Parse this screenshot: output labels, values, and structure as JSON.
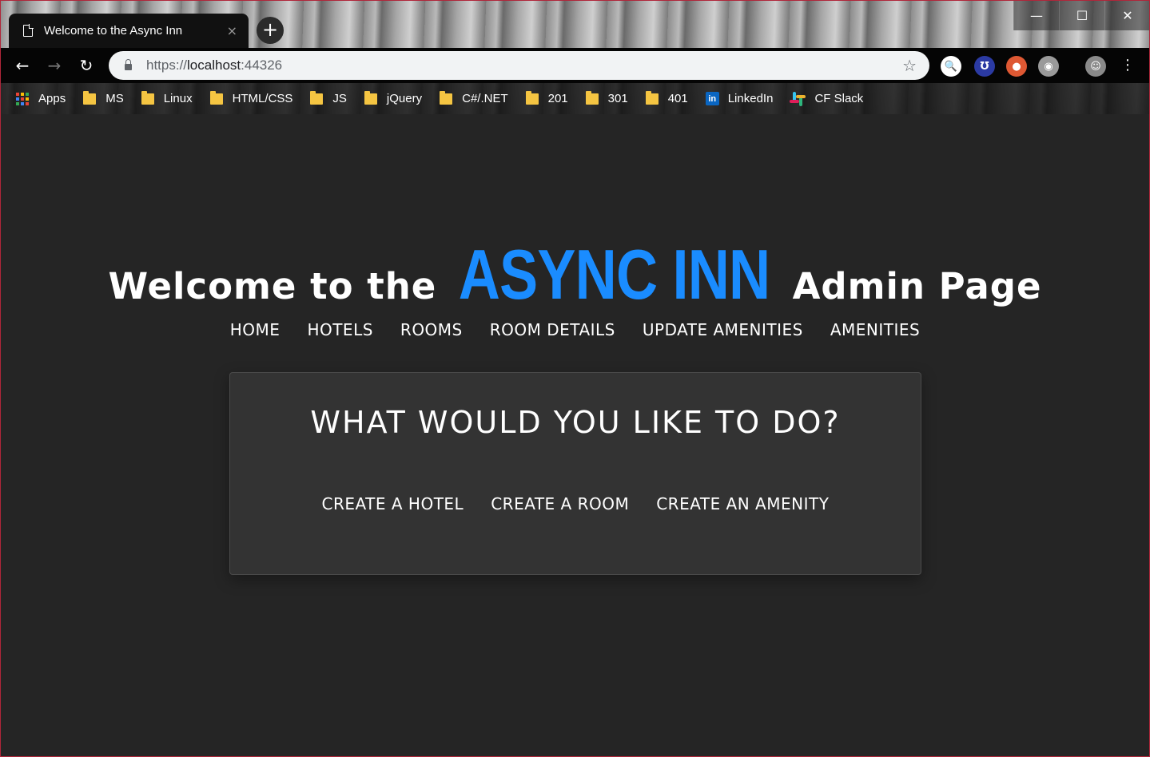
{
  "browser": {
    "tab_title": "Welcome to the Async Inn",
    "tab_close": "×",
    "new_tab": "+",
    "url_scheme": "https://",
    "url_host": "localhost",
    "url_port": ":44326",
    "window_controls": {
      "minimize": "—",
      "maximize": "☐",
      "close": "✕"
    },
    "nav": {
      "back": "←",
      "forward": "→",
      "reload": "↻"
    },
    "star": "☆",
    "extensions": [
      {
        "name": "search-extension-icon",
        "glyph": "🔍",
        "color": "#1a73e8"
      },
      {
        "name": "tampermonkey-icon",
        "glyph": "Ʊ",
        "color": "#2b3aa3"
      },
      {
        "name": "duckduckgo-icon",
        "glyph": "●",
        "color": "#de5833"
      },
      {
        "name": "ghostery-icon",
        "glyph": "◉",
        "color": "#9a9a9a"
      }
    ],
    "menu": "⋮"
  },
  "bookmarks": [
    {
      "label": "Apps",
      "type": "apps"
    },
    {
      "label": "MS",
      "type": "folder"
    },
    {
      "label": "Linux",
      "type": "folder"
    },
    {
      "label": "HTML/CSS",
      "type": "folder"
    },
    {
      "label": "JS",
      "type": "folder"
    },
    {
      "label": "jQuery",
      "type": "folder"
    },
    {
      "label": "C#/.NET",
      "type": "folder"
    },
    {
      "label": "201",
      "type": "folder"
    },
    {
      "label": "301",
      "type": "folder"
    },
    {
      "label": "401",
      "type": "folder"
    },
    {
      "label": "LinkedIn",
      "type": "linkedin"
    },
    {
      "label": "CF Slack",
      "type": "slack"
    }
  ],
  "hero": {
    "prefix": "Welcome to the",
    "brand": "ASYNC INN",
    "suffix": "Admin Page",
    "brand_color": "#1a8cff"
  },
  "nav": [
    "HOME",
    "HOTELS",
    "ROOMS",
    "ROOM DETAILS",
    "UPDATE AMENITIES",
    "AMENITIES"
  ],
  "card": {
    "heading": "WHAT WOULD YOU LIKE TO DO?",
    "actions": [
      "CREATE A HOTEL",
      "CREATE A ROOM",
      "CREATE AN AMENITY"
    ]
  }
}
